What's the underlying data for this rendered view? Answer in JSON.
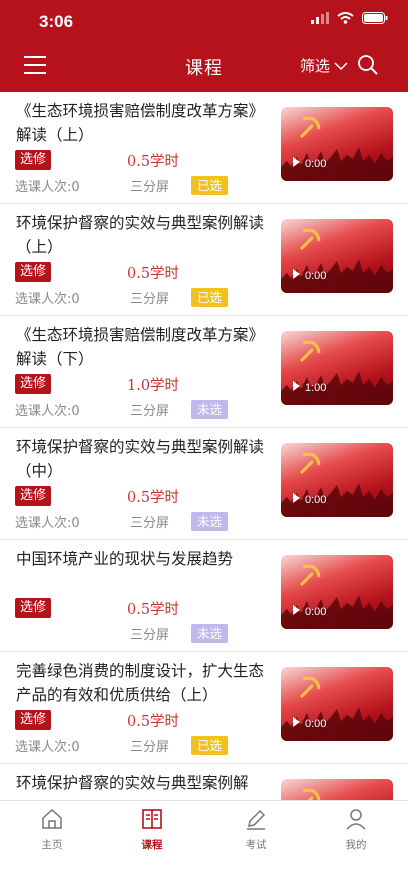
{
  "status": {
    "time": "3:06"
  },
  "nav": {
    "title": "课程",
    "filter_label": "筛选"
  },
  "courses": [
    {
      "title": "《生态环境损害赔偿制度改革方案》解读（上）",
      "tag": "选修",
      "hours": "0.5学时",
      "count": "选课人次:0",
      "screen": "三分屏",
      "state": "已选",
      "duration": "0:00"
    },
    {
      "title": "环境保护督察的实效与典型案例解读（上）",
      "tag": "选修",
      "hours": "0.5学时",
      "count": "选课人次:0",
      "screen": "三分屏",
      "state": "已选",
      "duration": "0:00"
    },
    {
      "title": "《生态环境损害赔偿制度改革方案》解读（下）",
      "tag": "选修",
      "hours": "1.0学时",
      "count": "选课人次:0",
      "screen": "三分屏",
      "state": "未选",
      "duration": "1:00"
    },
    {
      "title": "环境保护督察的实效与典型案例解读（中）",
      "tag": "选修",
      "hours": "0.5学时",
      "count": "选课人次:0",
      "screen": "三分屏",
      "state": "未选",
      "duration": "0:00"
    },
    {
      "title": "中国环境产业的现状与发展趋势",
      "tag": "选修",
      "hours": "0.5学时",
      "count": "",
      "screen": "三分屏",
      "state": "未选",
      "duration": "0:00"
    },
    {
      "title": "完善绿色消费的制度设计，扩大生态产品的有效和优质供给（上）",
      "tag": "选修",
      "hours": "0.5学时",
      "count": "选课人次:0",
      "screen": "三分屏",
      "state": "已选",
      "duration": "0:00"
    },
    {
      "title": "环境保护督察的实效与典型案例解",
      "tag": "",
      "hours": "",
      "count": "",
      "screen": "",
      "state": "",
      "duration": ""
    }
  ],
  "tabs": [
    {
      "label": "主页",
      "icon": "home-icon"
    },
    {
      "label": "课程",
      "icon": "book-icon"
    },
    {
      "label": "考试",
      "icon": "pen-icon"
    },
    {
      "label": "我的",
      "icon": "user-icon"
    }
  ],
  "colors": {
    "brand": "#b5121b",
    "selected": "#f1c21b",
    "unselected": "#c3b8ec"
  }
}
